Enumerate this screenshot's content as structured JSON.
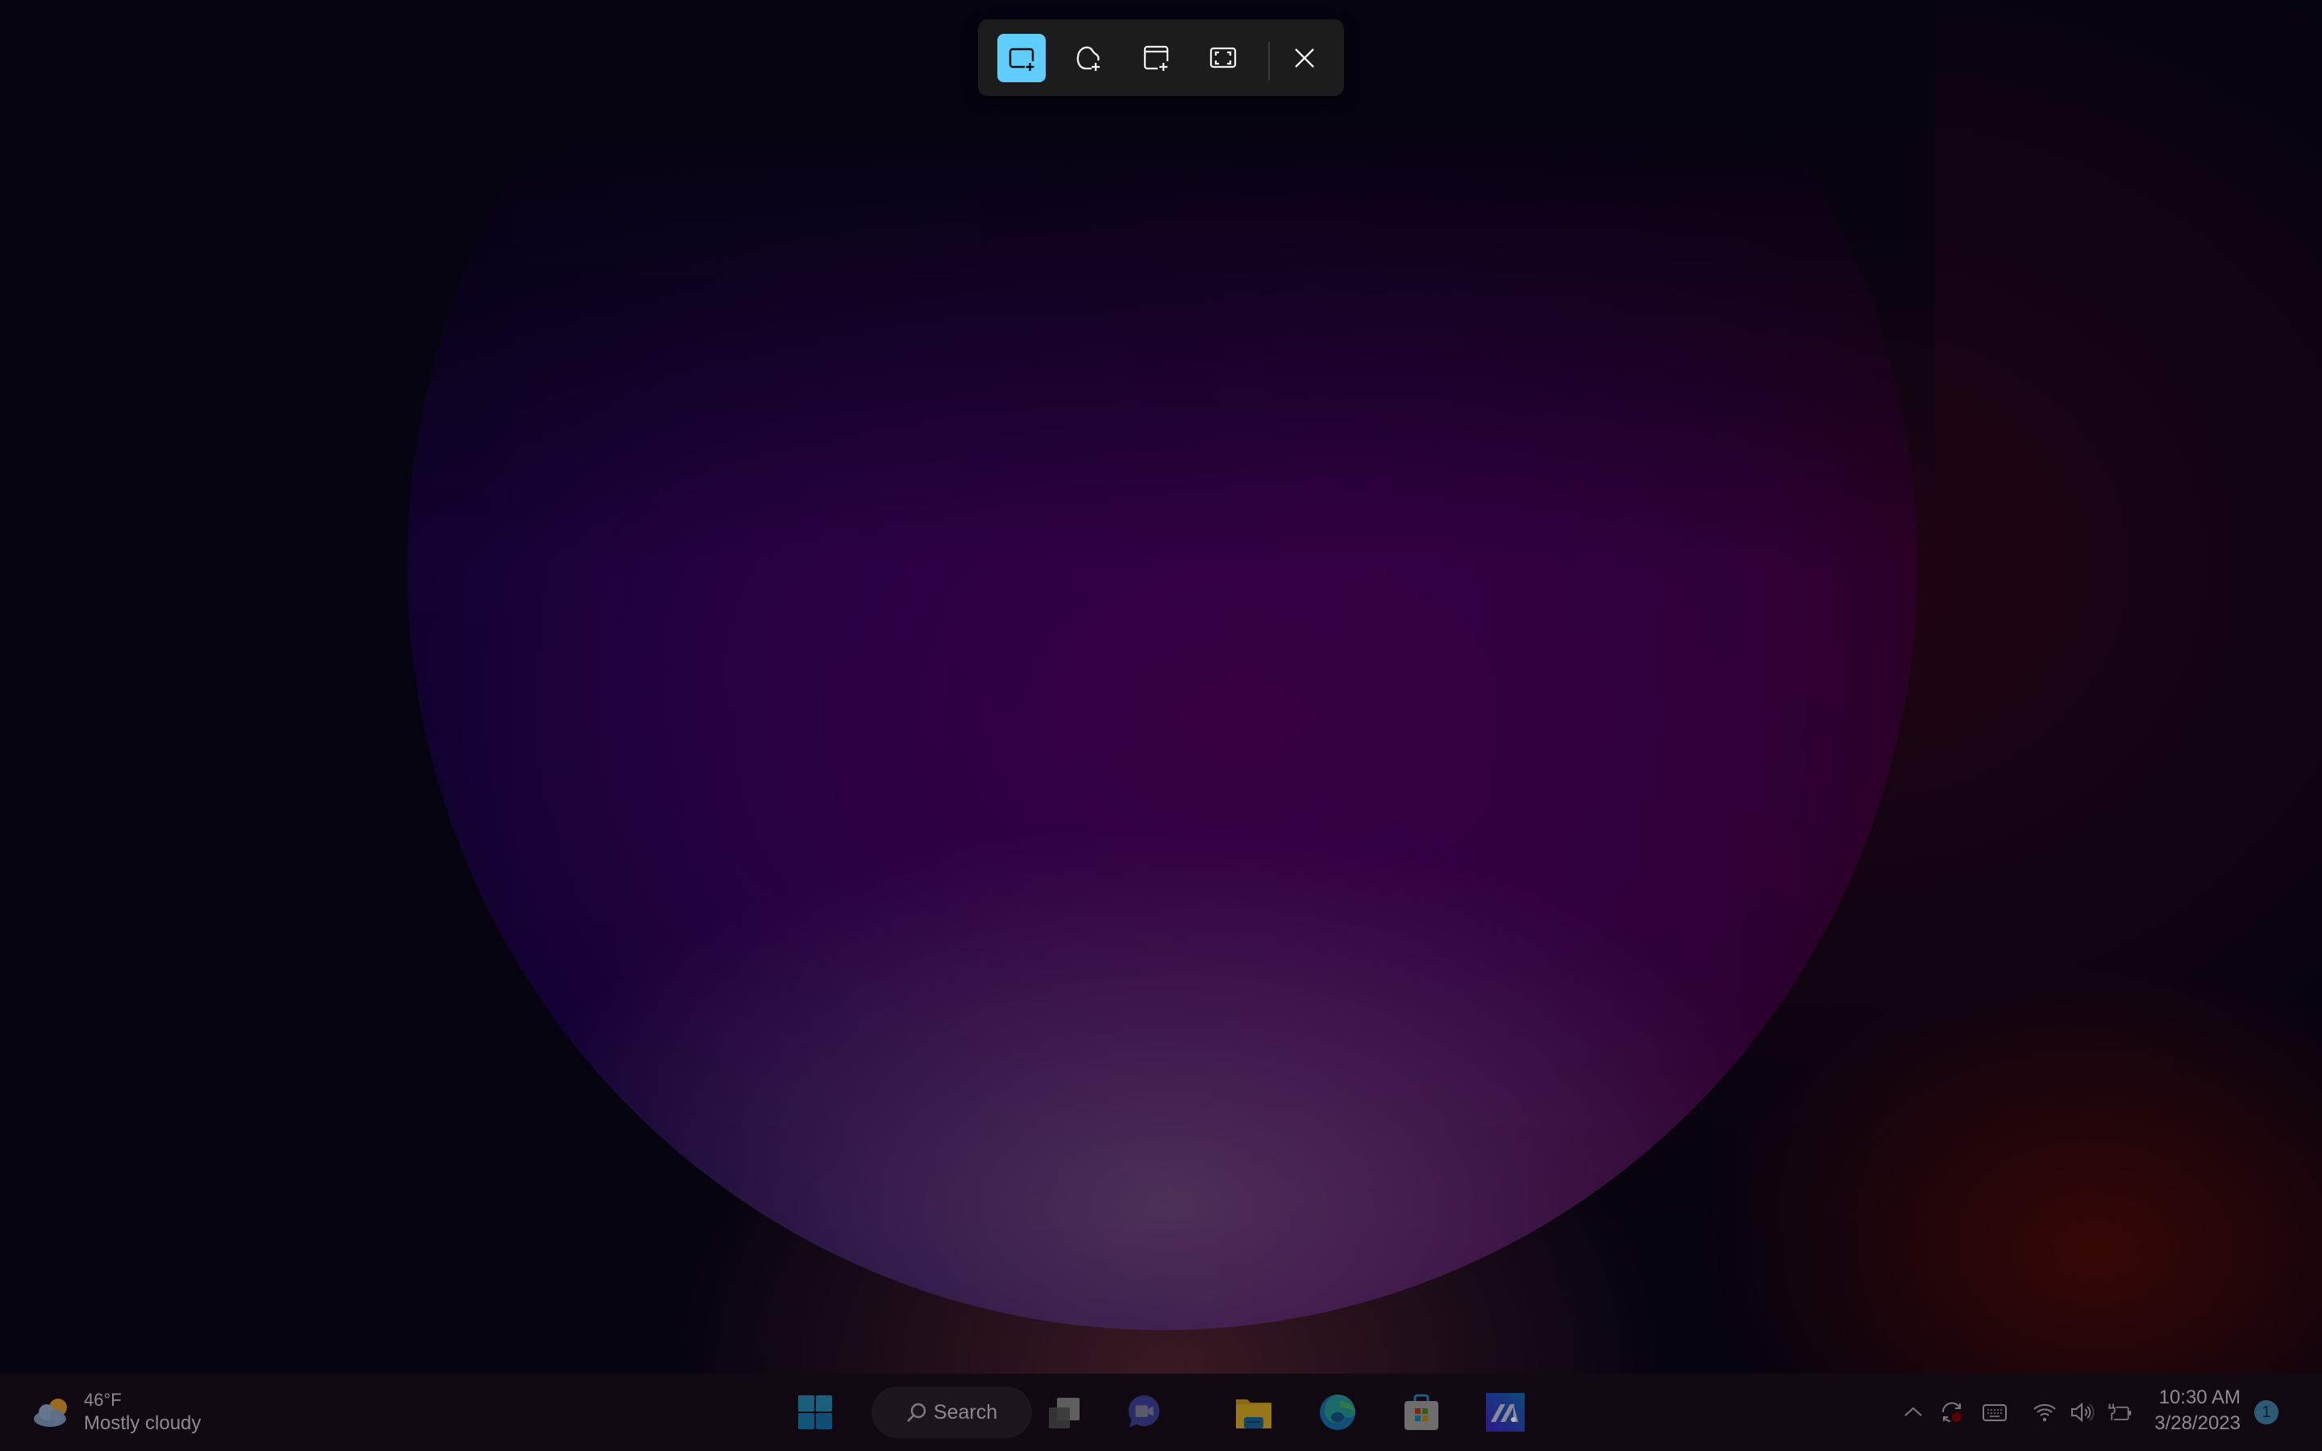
{
  "snip_toolbar": {
    "modes": [
      {
        "name": "rectangle-mode",
        "icon": "rectangle-snip-icon",
        "active": true
      },
      {
        "name": "freeform-mode",
        "icon": "freeform-snip-icon",
        "active": false
      },
      {
        "name": "window-mode",
        "icon": "window-snip-icon",
        "active": false
      },
      {
        "name": "fullscreen-mode",
        "icon": "fullscreen-snip-icon",
        "active": false
      }
    ],
    "close_icon": "close-icon",
    "accent": "#60cdff"
  },
  "taskbar": {
    "weather": {
      "temperature": "46°F",
      "condition": "Mostly cloudy",
      "icon": "partly-cloudy-icon"
    },
    "search": {
      "label": "Search",
      "icon": "search-icon"
    },
    "pinned": [
      {
        "name": "start",
        "icon": "windows-logo-icon"
      },
      {
        "name": "task-view",
        "icon": "task-view-icon"
      },
      {
        "name": "chat",
        "icon": "teams-chat-icon"
      },
      {
        "name": "file-explorer",
        "icon": "folder-icon"
      },
      {
        "name": "edge",
        "icon": "edge-icon"
      },
      {
        "name": "microsoft-store",
        "icon": "store-icon"
      },
      {
        "name": "app",
        "icon": "app-icon"
      }
    ],
    "tray": {
      "icons": [
        "chevron-up-icon",
        "sync-icon",
        "keyboard-icon",
        "wifi-icon",
        "volume-icon",
        "battery-charging-icon"
      ],
      "time": "10:30 AM",
      "date": "3/28/2023",
      "notification_count": "1"
    }
  }
}
